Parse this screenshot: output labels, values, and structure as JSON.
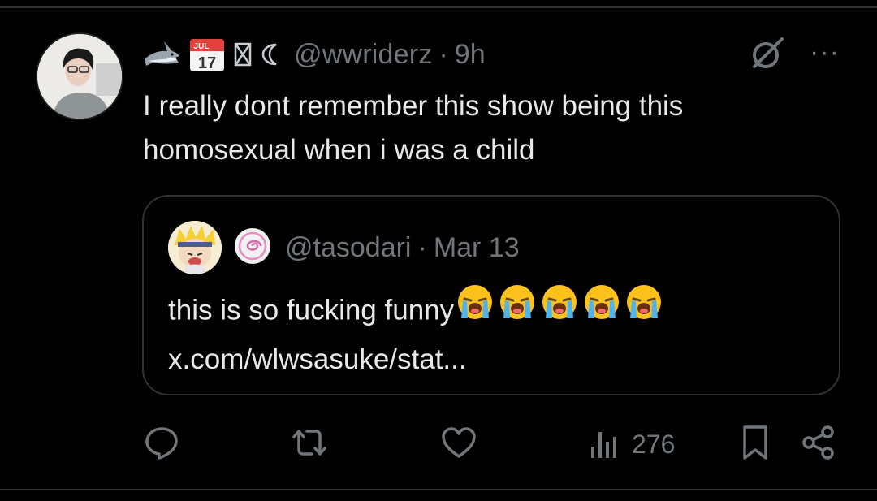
{
  "author": {
    "handle": "@wwriderz",
    "separator": "·",
    "time": "9h",
    "calendar_month": "JUL",
    "calendar_day": "17",
    "icon_names": [
      "shark-icon",
      "calendar-icon",
      "hourglass-icon",
      "moon-icon"
    ]
  },
  "post": {
    "text": "I really dont remember this show being this homosexual when i was a child"
  },
  "quote": {
    "handle": "@tasodari",
    "separator": "·",
    "date": "Mar 13",
    "text": "this is so fucking funny",
    "emoji": [
      "loudly-crying-face",
      "loudly-crying-face",
      "loudly-crying-face",
      "loudly-crying-face",
      "loudly-crying-face"
    ],
    "link": "x.com/wlwsasuke/stat..."
  },
  "more_label": "···",
  "metrics": {
    "views": "276"
  },
  "colors": {
    "background": "#000000",
    "text": "#e7e9ea",
    "muted": "#71767b",
    "border": "#2f3336"
  }
}
